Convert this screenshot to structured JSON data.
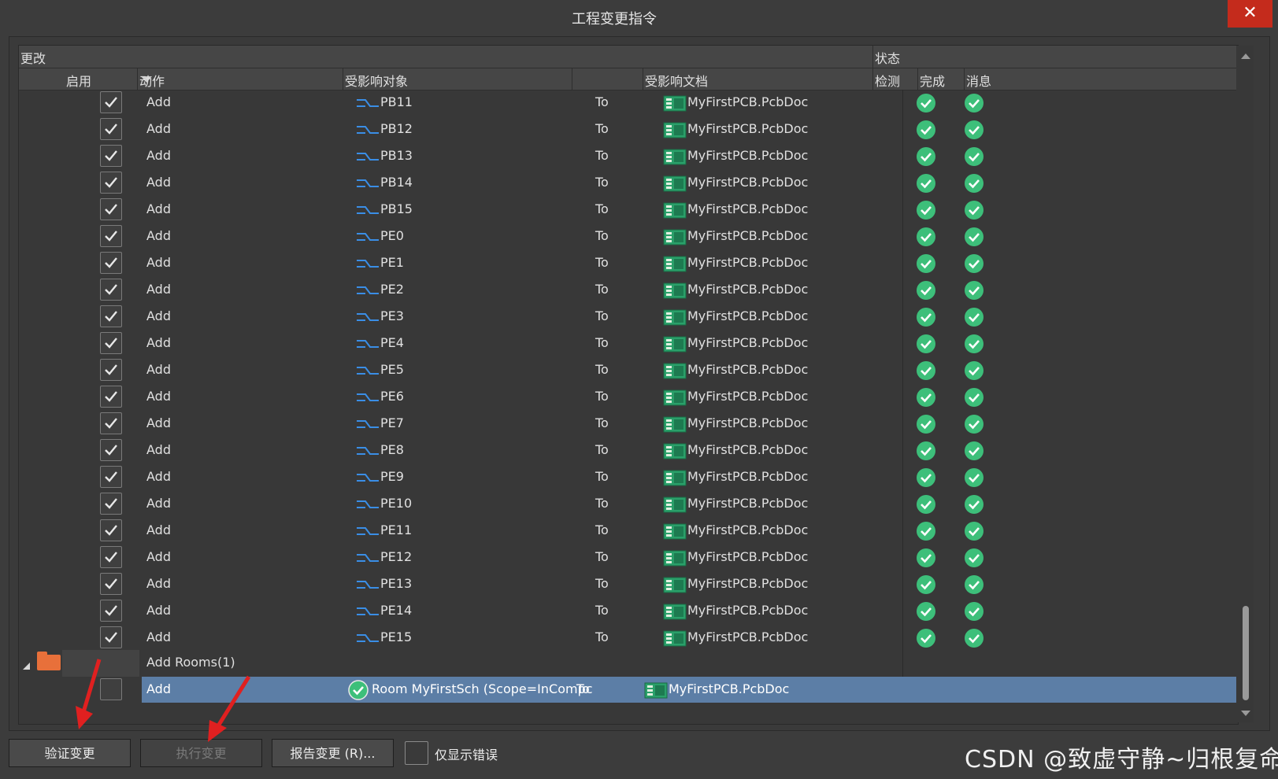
{
  "window": {
    "title": "工程变更指令",
    "close_label": "✕"
  },
  "table": {
    "group_header": "更改",
    "status_header": "状态",
    "columns": {
      "enable": "启用",
      "action": "动作",
      "affected_object": "受影响对象",
      "affected_doc": "受影响文档",
      "check": "检测",
      "done": "完成",
      "message": "消息"
    },
    "rows": [
      {
        "action": "Add",
        "object": "PB11",
        "to": "To",
        "doc": "MyFirstPCB.PcbDoc"
      },
      {
        "action": "Add",
        "object": "PB12",
        "to": "To",
        "doc": "MyFirstPCB.PcbDoc"
      },
      {
        "action": "Add",
        "object": "PB13",
        "to": "To",
        "doc": "MyFirstPCB.PcbDoc"
      },
      {
        "action": "Add",
        "object": "PB14",
        "to": "To",
        "doc": "MyFirstPCB.PcbDoc"
      },
      {
        "action": "Add",
        "object": "PB15",
        "to": "To",
        "doc": "MyFirstPCB.PcbDoc"
      },
      {
        "action": "Add",
        "object": "PE0",
        "to": "To",
        "doc": "MyFirstPCB.PcbDoc"
      },
      {
        "action": "Add",
        "object": "PE1",
        "to": "To",
        "doc": "MyFirstPCB.PcbDoc"
      },
      {
        "action": "Add",
        "object": "PE2",
        "to": "To",
        "doc": "MyFirstPCB.PcbDoc"
      },
      {
        "action": "Add",
        "object": "PE3",
        "to": "To",
        "doc": "MyFirstPCB.PcbDoc"
      },
      {
        "action": "Add",
        "object": "PE4",
        "to": "To",
        "doc": "MyFirstPCB.PcbDoc"
      },
      {
        "action": "Add",
        "object": "PE5",
        "to": "To",
        "doc": "MyFirstPCB.PcbDoc"
      },
      {
        "action": "Add",
        "object": "PE6",
        "to": "To",
        "doc": "MyFirstPCB.PcbDoc"
      },
      {
        "action": "Add",
        "object": "PE7",
        "to": "To",
        "doc": "MyFirstPCB.PcbDoc"
      },
      {
        "action": "Add",
        "object": "PE8",
        "to": "To",
        "doc": "MyFirstPCB.PcbDoc"
      },
      {
        "action": "Add",
        "object": "PE9",
        "to": "To",
        "doc": "MyFirstPCB.PcbDoc"
      },
      {
        "action": "Add",
        "object": "PE10",
        "to": "To",
        "doc": "MyFirstPCB.PcbDoc"
      },
      {
        "action": "Add",
        "object": "PE11",
        "to": "To",
        "doc": "MyFirstPCB.PcbDoc"
      },
      {
        "action": "Add",
        "object": "PE12",
        "to": "To",
        "doc": "MyFirstPCB.PcbDoc"
      },
      {
        "action": "Add",
        "object": "PE13",
        "to": "To",
        "doc": "MyFirstPCB.PcbDoc"
      },
      {
        "action": "Add",
        "object": "PE14",
        "to": "To",
        "doc": "MyFirstPCB.PcbDoc"
      },
      {
        "action": "Add",
        "object": "PE15",
        "to": "To",
        "doc": "MyFirstPCB.PcbDoc"
      }
    ],
    "group": {
      "label": "Add Rooms(1)"
    },
    "selected_row": {
      "action": "Add",
      "object": "Room MyFirstSch (Scope=InCompc",
      "to": "To",
      "doc": "MyFirstPCB.PcbDoc"
    }
  },
  "footer": {
    "validate_label": "验证变更",
    "execute_label": "执行变更",
    "report_label": "报告变更 (R)...",
    "only_errors_label": "仅显示错误",
    "watermark": "CSDN @致虚守静~归根复命"
  },
  "colors": {
    "background": "#3c3c3c",
    "selection": "#5c7ea6",
    "check_green": "#3dbf7a",
    "close_red": "#c42b1c",
    "net_icon_blue": "#3a8ee6",
    "arrow_red": "#e02020"
  },
  "icons": {
    "net": "net-icon",
    "pcb_doc": "pcb-doc-icon",
    "status_ok": "check-circle-icon",
    "folder": "folder-icon"
  }
}
